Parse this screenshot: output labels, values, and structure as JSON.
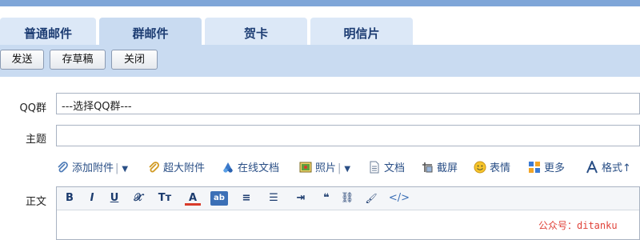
{
  "tabs": [
    {
      "label": "普通邮件"
    },
    {
      "label": "群邮件"
    },
    {
      "label": "贺卡"
    },
    {
      "label": "明信片"
    }
  ],
  "actions": {
    "send": "发送",
    "save_draft": "存草稿",
    "close": "关闭"
  },
  "form": {
    "qq_group_label": "QQ群",
    "qq_group_value": "---选择QQ群---",
    "subject_label": "主题",
    "subject_value": "",
    "body_label": "正文"
  },
  "attachments": {
    "add_attachment": "添加附件",
    "large_attachment": "超大附件",
    "online_doc": "在线文档",
    "photo": "照片",
    "document": "文档",
    "screenshot": "截屏",
    "emoji": "表情",
    "more": "更多",
    "format": "格式↑"
  },
  "editor_toolbar": {
    "bold": "B",
    "italic": "I",
    "underline": "U",
    "clear_format": "𝒳",
    "font_size": "Tт",
    "font_color": "A",
    "highlight": "ab",
    "align": "≡",
    "bullet_list": "☰",
    "indent": "⇥",
    "quote": "❝",
    "link": "⛓",
    "paint": "🖌",
    "code": "</>"
  },
  "watermark": "公众号：ditanku",
  "colors": {
    "accent": "#7fa6d8",
    "tab_bg": "#dce8f7",
    "toolbar_bg": "#c9dbf1",
    "watermark": "#e0433a"
  }
}
